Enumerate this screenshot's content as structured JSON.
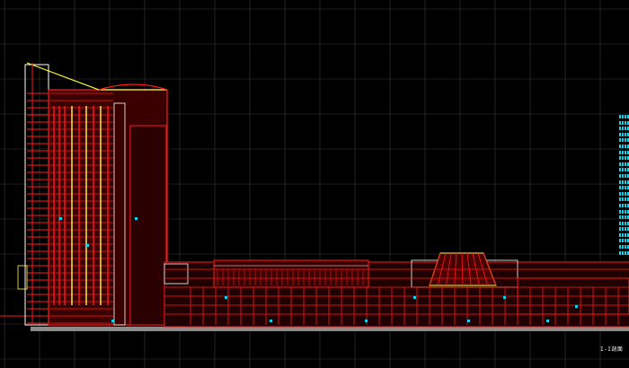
{
  "drawing": {
    "background": "#000000",
    "grid_color": "#3a3a3a",
    "line_colors": {
      "structure": "#ff1a1a",
      "accent": "#ffff33",
      "annotation": "#19d0e6",
      "outline": "#ffffff",
      "ground": "#b0b0b0"
    }
  },
  "title_block": {
    "label": "I-I剖面"
  },
  "legend": {
    "color": "#19d0e6",
    "rows": 24
  }
}
